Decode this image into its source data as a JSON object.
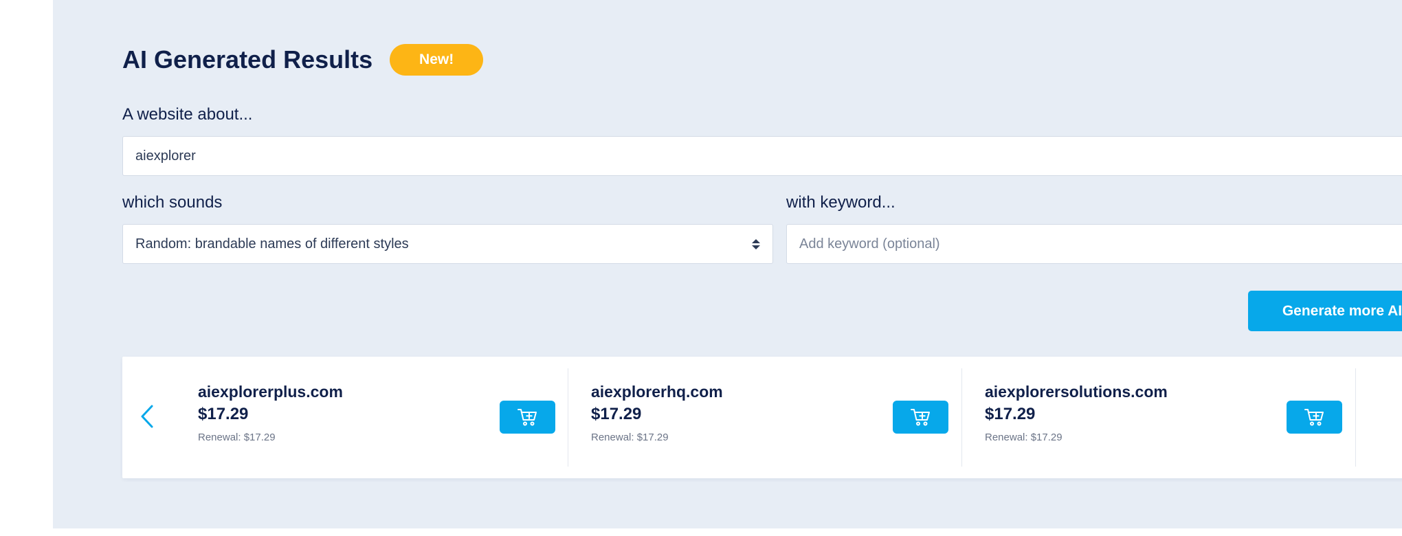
{
  "header": {
    "title": "AI Generated Results",
    "badge": "New!"
  },
  "form": {
    "about_label": "A website about...",
    "about_value": "aiexplorer",
    "sounds_label": "which sounds",
    "sounds_selected": "Random: brandable names of different styles",
    "keyword_label": "with keyword...",
    "keyword_placeholder": "Add keyword (optional)",
    "keyword_value": "",
    "generate_label": "Generate more AI"
  },
  "results": [
    {
      "domain": "aiexplorerplus.com",
      "price": "$17.29",
      "renewal": "Renewal: $17.29"
    },
    {
      "domain": "aiexplorerhq.com",
      "price": "$17.29",
      "renewal": "Renewal: $17.29"
    },
    {
      "domain": "aiexplorersolutions.com",
      "price": "$17.29",
      "renewal": "Renewal: $17.29"
    }
  ],
  "icons": {
    "prev": "chevron-left-icon",
    "next": "chevron-right-icon",
    "cart": "cart-add-icon"
  },
  "colors": {
    "accent": "#07a8ea",
    "badge": "#fdb515",
    "panel_bg": "#e7edf5",
    "text_dark": "#10204a"
  }
}
